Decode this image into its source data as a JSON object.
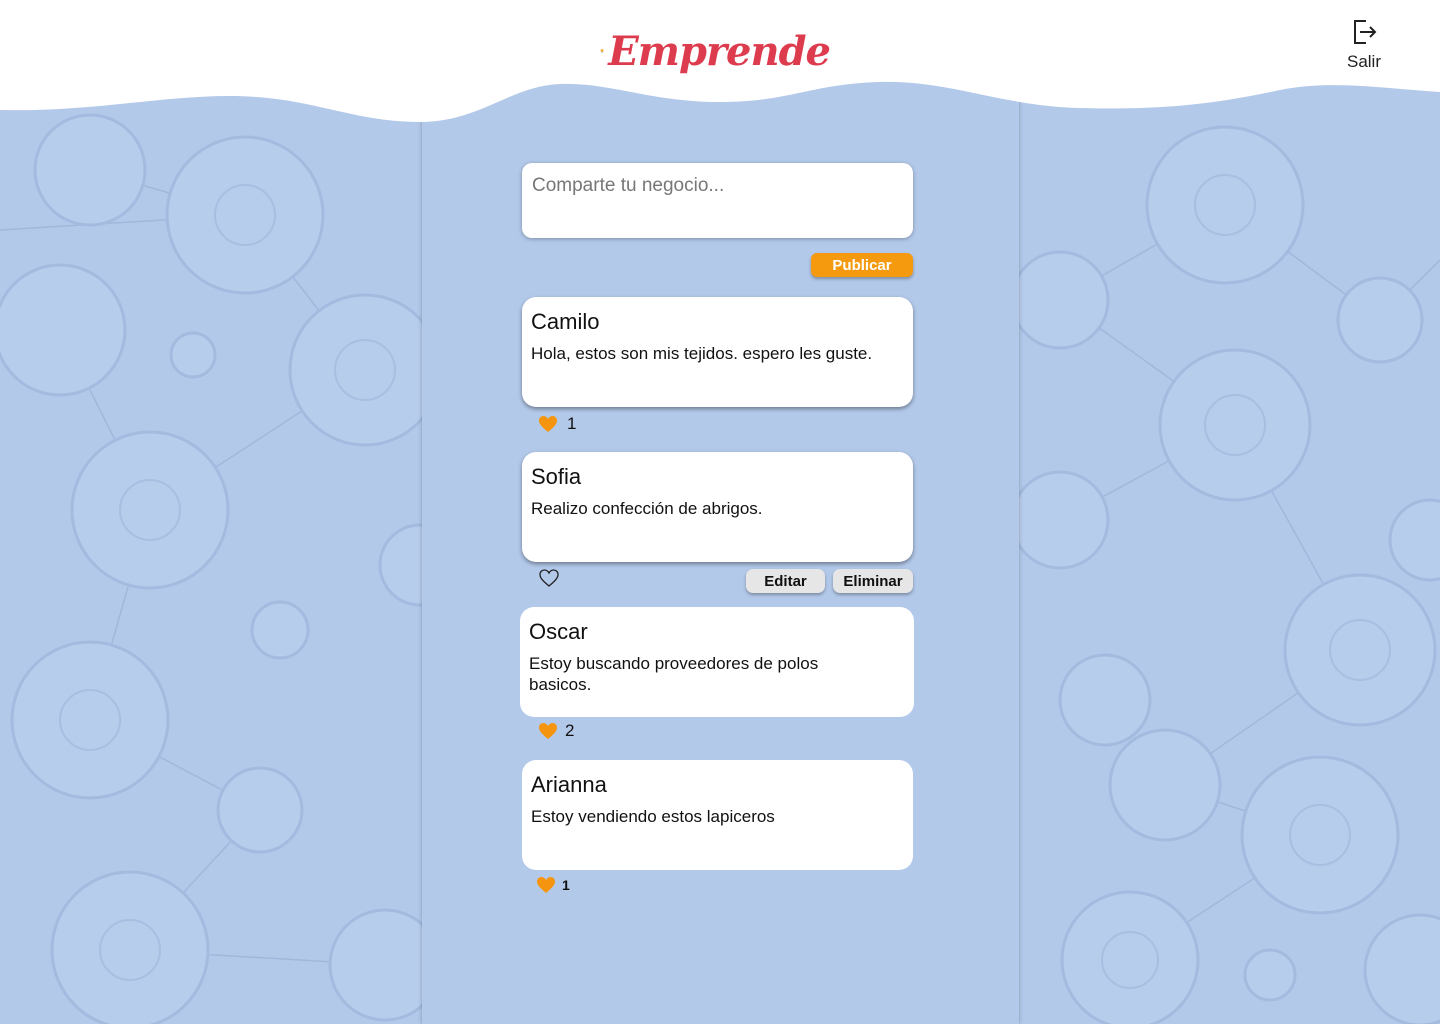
{
  "header": {
    "brand": "Emprende",
    "logout_label": "Salir"
  },
  "composer": {
    "placeholder": "Comparte tu negocio...",
    "publish_label": "Publicar"
  },
  "posts": [
    {
      "author": "Camilo",
      "text": "Hola, estos son mis tejidos. espero les guste.",
      "likes": "1",
      "liked": true
    },
    {
      "author": "Sofia",
      "text": "Realizo confección de abrigos.",
      "likes": "",
      "liked": false,
      "edit_label": "Editar",
      "delete_label": "Eliminar"
    },
    {
      "author": "Oscar",
      "text": "Estoy buscando proveedores de polos basicos.",
      "likes": "2",
      "liked": true
    },
    {
      "author": "Arianna",
      "text": "Estoy vendiendo estos lapiceros",
      "likes": "1",
      "liked": true
    }
  ],
  "colors": {
    "background": "#b3c9ea",
    "accent": "#f59a0f",
    "brand": "#dd3b4e",
    "heart": "#f5950f"
  },
  "icons": {
    "logo": "lightbulb-heart-icon",
    "logout": "logout-icon",
    "like_filled": "heart-filled-icon",
    "like_empty": "heart-outline-icon"
  }
}
